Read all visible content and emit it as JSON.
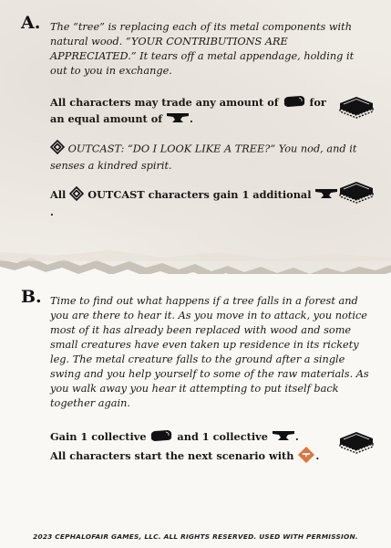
{
  "section_a": {
    "letter": "A.",
    "intro": "The “tree” is replacing each of its metal components with natural wood. “YOUR CONTRIBUTIONS ARE APPRECIATED.” It tears off a metal appendage, holding it out to you in exchange.",
    "trade_part1": "All characters may trade any amount of",
    "trade_part2": "for",
    "trade_part3": "an equal amount of",
    "trade_part4": ".",
    "outcast_label": "OUTCAST:",
    "outcast_quote": "“DO I LOOK LIKE A TREE?”",
    "outcast_rest": "You nod, and it senses a kindred spirit.",
    "gain_part1": "All",
    "gain_part2": "OUTCAST characters gain 1 additional",
    "gain_part3": "."
  },
  "section_b": {
    "letter": "B.",
    "intro": "Time to find out what happens if a tree falls in a forest and you are there to hear it. As you move in to attack, you notice most of it has already been replaced with wood and some small creatures have even taken up residence in its rickety leg. The metal creature falls to the ground after a single swing and you help yourself to some of the raw materials. As you walk away you hear it attempting to put itself back together again.",
    "gain1_part1": "Gain 1 collective",
    "gain1_part2": "and 1 collective",
    "gain1_part3": ".",
    "gain2_part1": "All characters start the next scenario with",
    "gain2_part2": "."
  },
  "footer": "2023 CEPHALOFAIR GAMES, LLC. ALL RIGHTS RESERVED. USED WITH PERMISSION.",
  "icons": {
    "wood": "wood-icon",
    "metal": "anvil-icon",
    "outcast": "outcast-class-icon",
    "campaign": "campaign-sheet-icon",
    "condition": "condition-token-icon"
  },
  "colors": {
    "ink": "#1a1714",
    "token": "#e0743a",
    "paper_top": "#efebe5",
    "paper_bottom": "#faf8f5"
  }
}
